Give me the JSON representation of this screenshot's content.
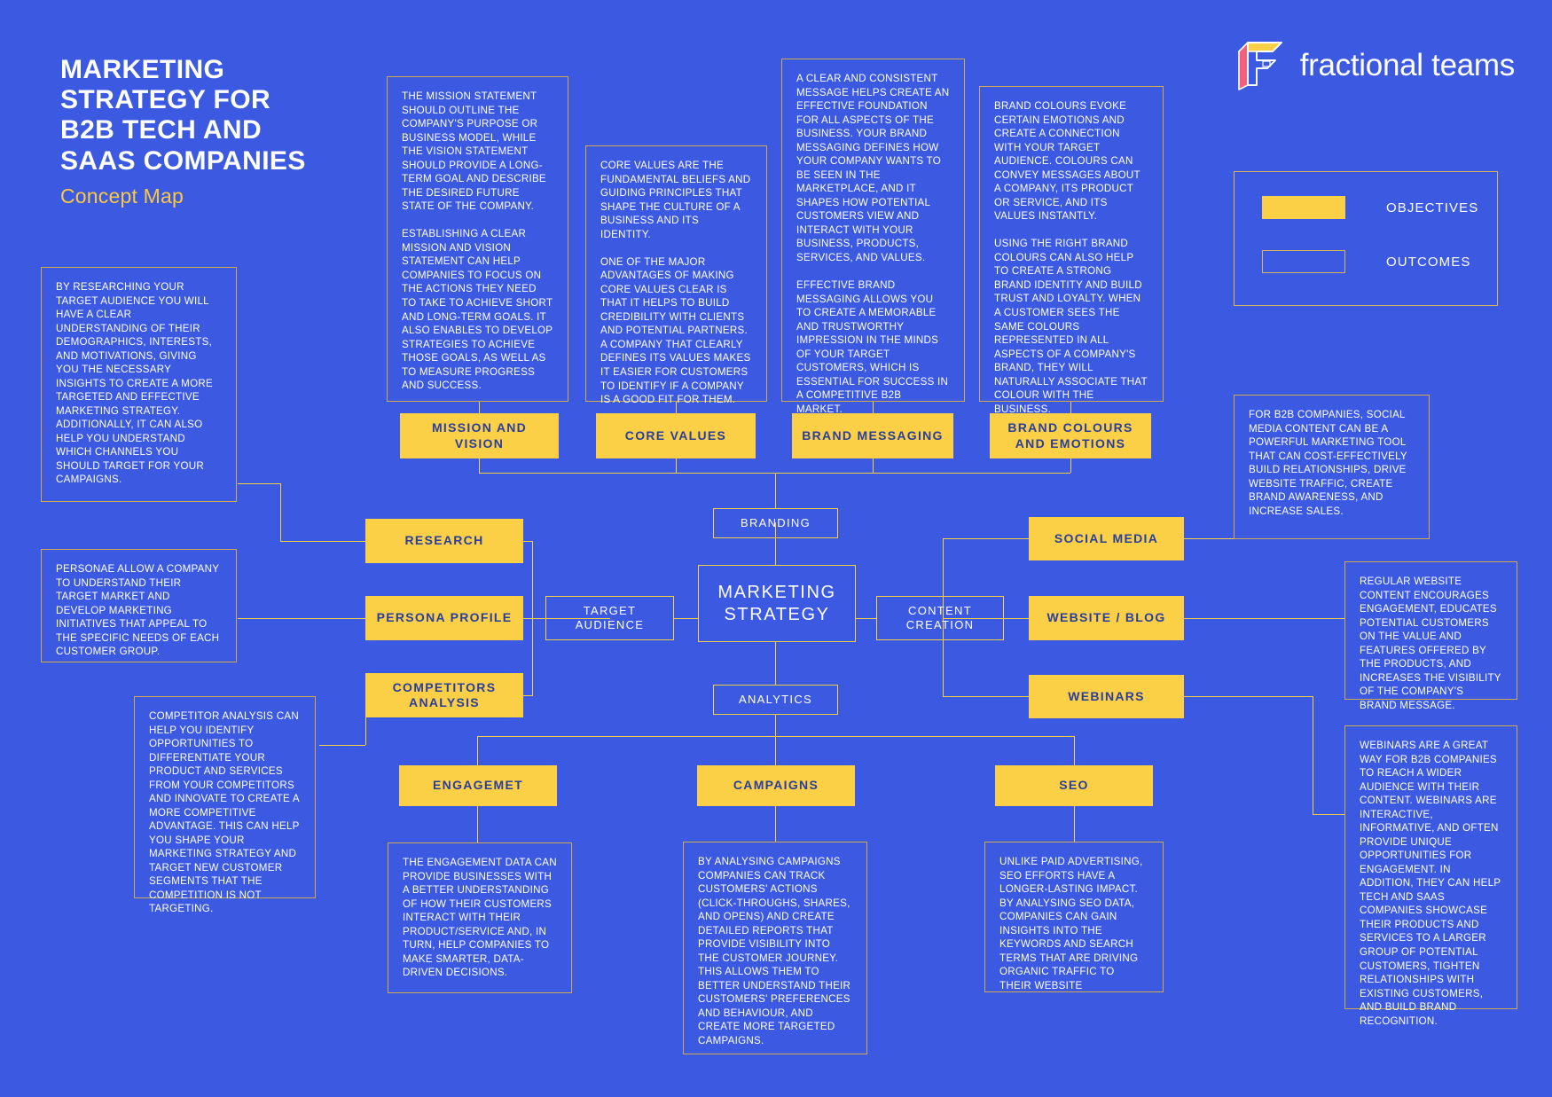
{
  "header": {
    "title": "MARKETING\nSTRATEGY FOR\nB2B TECH AND\nSAAS COMPANIES",
    "subtitle": "Concept Map",
    "logo_text": "fractional teams",
    "logo_icon": "fractional-f-logo-icon"
  },
  "legend": {
    "items": [
      {
        "label": "OBJECTIVES",
        "style": "filled",
        "color": "#FBCF46"
      },
      {
        "label": "OUTCOMES",
        "style": "outline",
        "color": "#FBCF46"
      }
    ]
  },
  "nodes": {
    "center": "MARKETING\nSTRATEGY",
    "branding": "BRANDING",
    "target_audience": "TARGET\nAUDIENCE",
    "content_creation": "CONTENT\nCREATION",
    "analytics": "ANALYTICS",
    "mission_vision": "MISSION AND\nVISION",
    "core_values": "CORE VALUES",
    "brand_messaging": "BRAND MESSAGING",
    "brand_colours": "BRAND COLOURS\nAND EMOTIONS",
    "research": "RESEARCH",
    "persona_profile": "PERSONA PROFILE",
    "competitors_analysis": "COMPETITORS\nANALYSIS",
    "social_media": "SOCIAL MEDIA",
    "website_blog": "WEBSITE / BLOG",
    "webinars": "WEBINARS",
    "engagement": "ENGAGEMET",
    "campaigns": "CAMPAIGNS",
    "seo": "SEO"
  },
  "notes": {
    "research": "BY RESEARCHING YOUR TARGET AUDIENCE YOU WILL HAVE A CLEAR UNDERSTANDING OF THEIR DEMOGRAPHICS, INTERESTS, AND MOTIVATIONS, GIVING YOU THE NECESSARY INSIGHTS TO CREATE A MORE TARGETED AND EFFECTIVE MARKETING STRATEGY. ADDITIONALLY, IT CAN ALSO HELP YOU UNDERSTAND WHICH CHANNELS YOU SHOULD TARGET FOR YOUR CAMPAIGNS.",
    "persona": "PERSONAE ALLOW A COMPANY TO UNDERSTAND THEIR TARGET MARKET AND DEVELOP MARKETING INITIATIVES THAT APPEAL TO THE SPECIFIC NEEDS OF EACH CUSTOMER GROUP.",
    "competitors": "COMPETITOR ANALYSIS CAN HELP YOU IDENTIFY OPPORTUNITIES TO DIFFERENTIATE YOUR PRODUCT AND SERVICES FROM YOUR COMPETITORS AND INNOVATE TO CREATE A MORE COMPETITIVE ADVANTAGE. THIS CAN HELP YOU SHAPE YOUR MARKETING STRATEGY AND TARGET NEW CUSTOMER SEGMENTS THAT THE COMPETITION IS NOT TARGETING.",
    "mission_vision": "THE MISSION STATEMENT SHOULD OUTLINE THE COMPANY'S PURPOSE OR BUSINESS MODEL, WHILE THE VISION STATEMENT SHOULD PROVIDE A LONG-TERM GOAL AND DESCRIBE THE DESIRED FUTURE STATE OF THE COMPANY.\n\nESTABLISHING A CLEAR MISSION AND VISION STATEMENT CAN HELP COMPANIES TO FOCUS ON THE ACTIONS  THEY NEED TO TAKE TO ACHIEVE  SHORT AND LONG-TERM GOALS. IT ALSO ENABLES TO DEVELOP STRATEGIES TO ACHIEVE THOSE GOALS, AS WELL AS TO MEASURE PROGRESS AND SUCCESS.",
    "core_values": "CORE VALUES ARE THE FUNDAMENTAL BELIEFS AND GUIDING PRINCIPLES THAT SHAPE THE CULTURE OF A BUSINESS AND ITS IDENTITY.\n\nONE OF THE MAJOR ADVANTAGES OF MAKING CORE VALUES CLEAR IS THAT IT HELPS TO BUILD CREDIBILITY WITH CLIENTS AND POTENTIAL PARTNERS. A COMPANY THAT CLEARLY DEFINES ITS VALUES MAKES IT EASIER FOR CUSTOMERS TO IDENTIFY IF A COMPANY IS A GOOD FIT FOR THEM.",
    "brand_messaging": " A CLEAR AND CONSISTENT MESSAGE HELPS CREATE AN EFFECTIVE FOUNDATION FOR ALL ASPECTS OF THE BUSINESS. YOUR BRAND MESSAGING DEFINES HOW YOUR COMPANY WANTS TO BE SEEN IN THE MARKETPLACE, AND IT SHAPES HOW POTENTIAL CUSTOMERS VIEW AND INTERACT WITH YOUR BUSINESS, PRODUCTS, SERVICES, AND VALUES.\n\nEFFECTIVE BRAND MESSAGING ALLOWS YOU TO CREATE A MEMORABLE AND TRUSTWORTHY IMPRESSION IN THE MINDS OF YOUR TARGET CUSTOMERS, WHICH IS ESSENTIAL FOR SUCCESS IN A COMPETITIVE B2B MARKET.",
    "brand_colours": "BRAND COLOURS EVOKE CERTAIN EMOTIONS AND CREATE A CONNECTION WITH YOUR TARGET AUDIENCE. COLOURS CAN CONVEY MESSAGES ABOUT A COMPANY, ITS PRODUCT OR SERVICE, AND ITS VALUES INSTANTLY.\n\nUSING THE RIGHT BRAND COLOURS CAN ALSO HELP TO CREATE A STRONG BRAND IDENTITY AND BUILD TRUST AND LOYALTY. WHEN A CUSTOMER SEES THE SAME COLOURS REPRESENTED IN ALL ASPECTS OF A COMPANY'S BRAND, THEY WILL NATURALLY ASSOCIATE THAT COLOUR WITH THE BUSINESS.",
    "social_media": "FOR B2B COMPANIES, SOCIAL MEDIA CONTENT CAN BE A POWERFUL MARKETING TOOL THAT CAN COST-EFFECTIVELY BUILD RELATIONSHIPS, DRIVE WEBSITE TRAFFIC, CREATE BRAND AWARENESS, AND INCREASE SALES.",
    "website": "REGULAR WEBSITE CONTENT ENCOURAGES ENGAGEMENT, EDUCATES POTENTIAL CUSTOMERS ON THE VALUE AND FEATURES OFFERED BY THE PRODUCTS, AND INCREASES THE VISIBILITY OF THE COMPANY'S BRAND MESSAGE.",
    "webinars": "WEBINARS ARE A GREAT WAY FOR B2B  COMPANIES TO REACH A WIDER AUDIENCE WITH THEIR CONTENT. WEBINARS ARE INTERACTIVE, INFORMATIVE, AND OFTEN PROVIDE UNIQUE OPPORTUNITIES FOR ENGAGEMENT. IN ADDITION, THEY CAN HELP TECH AND SAAS COMPANIES SHOWCASE THEIR PRODUCTS AND SERVICES TO A LARGER GROUP OF POTENTIAL CUSTOMERS, TIGHTEN RELATIONSHIPS WITH EXISTING CUSTOMERS, AND BUILD BRAND RECOGNITION.",
    "engagement": "THE ENGAGEMENT DATA CAN PROVIDE BUSINESSES WITH A BETTER UNDERSTANDING OF HOW THEIR CUSTOMERS INTERACT WITH THEIR PRODUCT/SERVICE AND, IN TURN, HELP COMPANIES TO MAKE SMARTER, DATA-DRIVEN DECISIONS.",
    "campaigns": "BY ANALYSING CAMPAIGNS COMPANIES CAN TRACK CUSTOMERS' ACTIONS (CLICK-THROUGHS, SHARES, AND OPENS) AND CREATE DETAILED REPORTS THAT PROVIDE VISIBILITY INTO THE CUSTOMER JOURNEY. THIS ALLOWS THEM TO BETTER UNDERSTAND THEIR CUSTOMERS' PREFERENCES AND BEHAVIOUR, AND CREATE MORE TARGETED CAMPAIGNS.",
    "seo": "UNLIKE PAID ADVERTISING, SEO EFFORTS HAVE A LONGER-LASTING IMPACT. BY ANALYSING SEO DATA, COMPANIES CAN GAIN INSIGHTS INTO THE KEYWORDS AND SEARCH TERMS THAT ARE DRIVING ORGANIC TRAFFIC TO THEIR WEBSITE"
  },
  "colors": {
    "background": "#3C5AE1",
    "accent_yellow": "#FBCF46",
    "note_border": "#D0A94F",
    "text_white": "#FFFFFF"
  }
}
